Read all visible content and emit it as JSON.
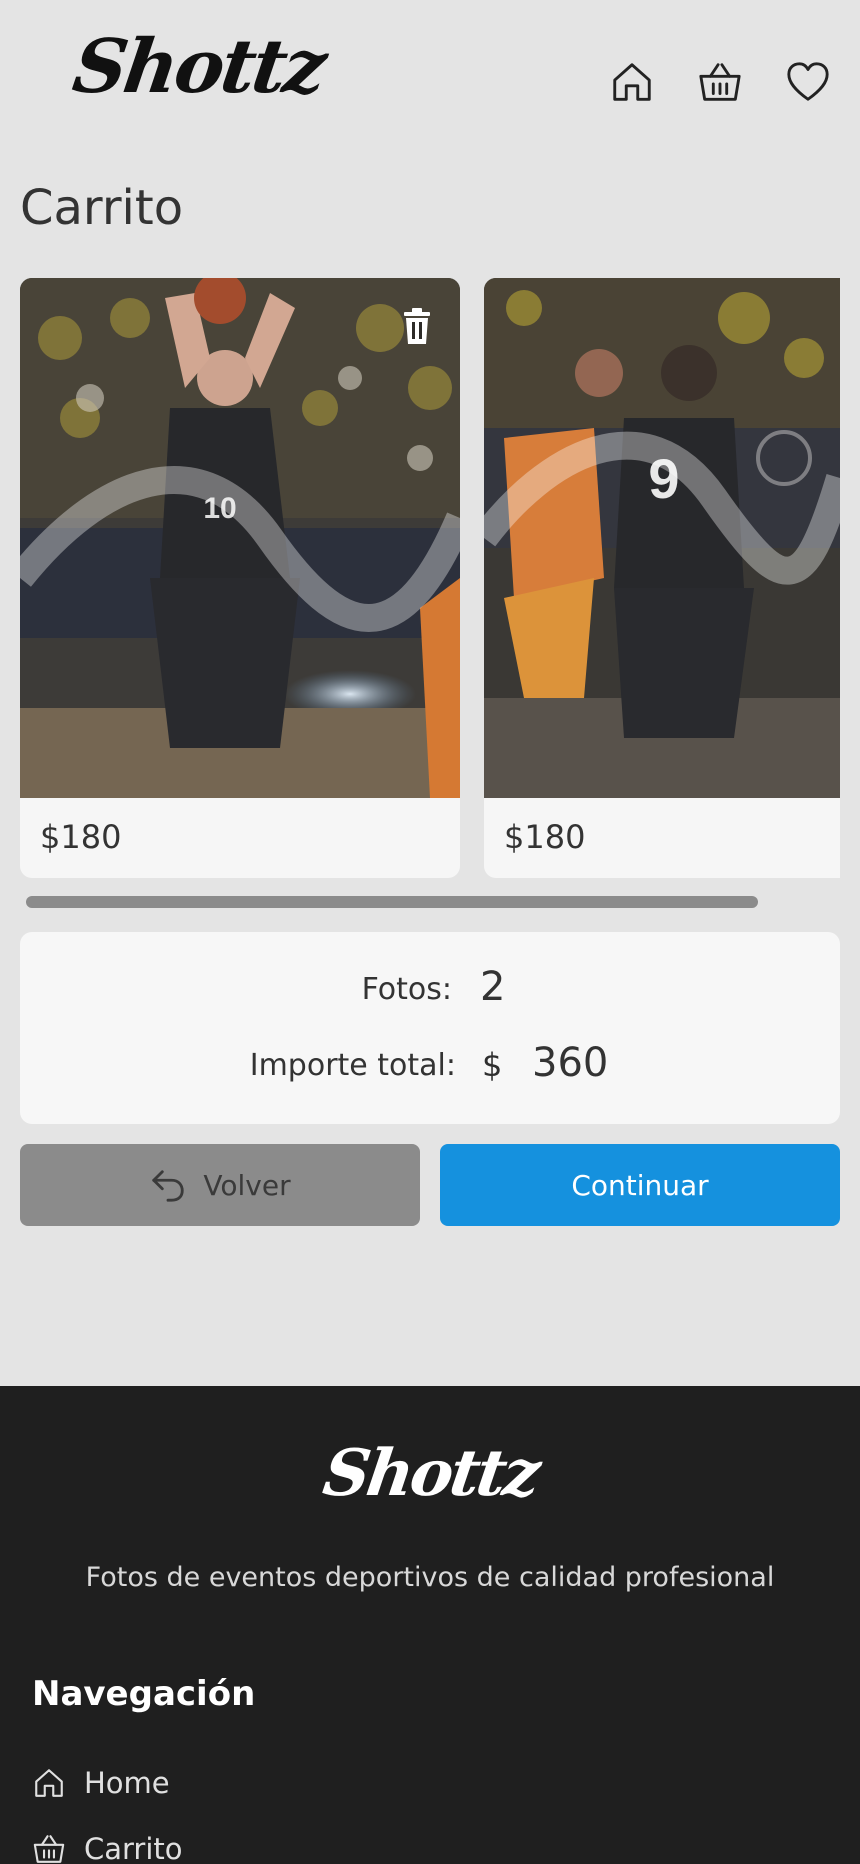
{
  "header": {
    "logo": "Shottz",
    "nav_icons": [
      "home-icon",
      "basket-icon",
      "heart-icon"
    ]
  },
  "page_title": "Carrito",
  "cart": {
    "items": [
      {
        "price": "$180",
        "player_number": "10",
        "photo": "basketball-player-10"
      },
      {
        "price": "$180",
        "player_number": "9",
        "photo": "basketball-player-9"
      }
    ]
  },
  "summary": {
    "photos_label": "Fotos:",
    "photos_count": "2",
    "total_label": "Importe total:",
    "currency": "$",
    "total_value": "360"
  },
  "buttons": {
    "back_label": "Volver",
    "continue_label": "Continuar"
  },
  "footer": {
    "logo": "Shottz",
    "tagline": "Fotos de eventos deportivos de calidad profesional",
    "nav_heading": "Navegación",
    "links": [
      {
        "label": "Home",
        "icon": "home-icon"
      },
      {
        "label": "Carrito",
        "icon": "basket-icon"
      }
    ]
  },
  "colors": {
    "background": "#e4e4e4",
    "primary": "#1591de",
    "secondary": "#8b8b8b",
    "footer": "#1f1f1f"
  }
}
